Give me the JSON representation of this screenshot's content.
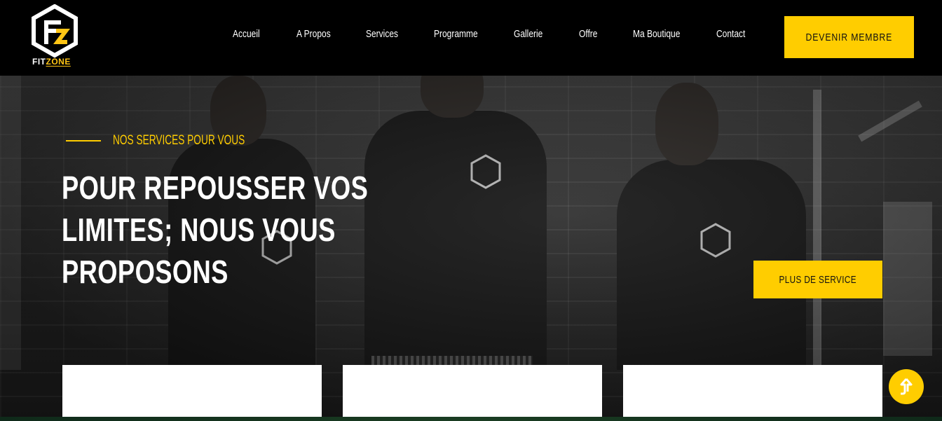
{
  "brand": {
    "logo_fit": "FIT",
    "logo_zone": "ZONE",
    "accent_color": "#ffcd00"
  },
  "nav": {
    "items": [
      {
        "label": "Accueil"
      },
      {
        "label": "A Propos"
      },
      {
        "label": "Services"
      },
      {
        "label": "Programme"
      },
      {
        "label": "Gallerie"
      },
      {
        "label": "Offre"
      },
      {
        "label": "Ma Boutique"
      },
      {
        "label": "Contact"
      }
    ],
    "cta_label": "DEVENIR MEMBRE"
  },
  "hero": {
    "eyebrow": "NOS SERVICES POUR VOUS",
    "headline_lines": [
      "POUR REPOUSSER VOS",
      "LIMITES; NOUS VOUS",
      "PROPOSONS"
    ],
    "cta_label": "PLUS DE SERVICE"
  },
  "scroll_top": {
    "icon": "arrow-up-icon"
  }
}
